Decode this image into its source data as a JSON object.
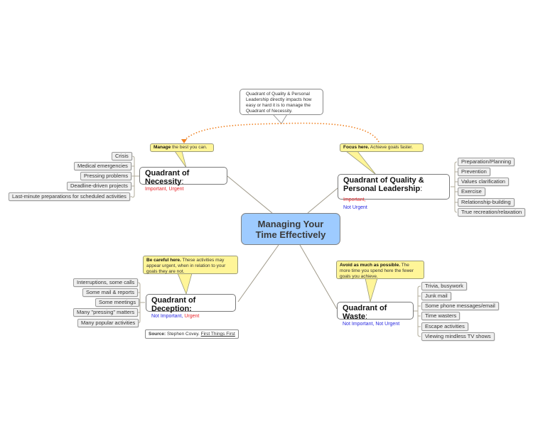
{
  "central": {
    "line1": "Managing Your",
    "line2": "Time Effectively"
  },
  "quadrants": {
    "necessity": {
      "title": "Quadrant of Necessity",
      "colon": ":",
      "importance": "Important",
      "sep": ", ",
      "urgency": "Urgent",
      "items": [
        "Crisis",
        "Medical emergencies",
        "Pressing problems",
        "Deadline-driven projects",
        "Last-minute preparations for scheduled activities"
      ],
      "callout": {
        "bold": "Manage",
        "text": " the best you can."
      }
    },
    "quality": {
      "title_line1": "Quadrant of Quality &",
      "title_line2": "Personal Leadership",
      "colon": ":",
      "importance": " Important,",
      "urgency": "Not Urgent",
      "items": [
        "Preparation/Planning",
        "Prevention",
        "Values clarification",
        "Exercise",
        "Relationship-building",
        "True recreation/relaxation"
      ],
      "callout": {
        "bold": "Focus here.",
        "text": "  Achieve goals faster."
      }
    },
    "deception": {
      "title": "Quadrant of Deception:",
      "importance": "Not Important",
      "sep": ", ",
      "urgency": "Urgent",
      "items": [
        "Interruptions, some calls",
        "Some mail & reports",
        "Some meetings",
        "Many \"pressing\" matters",
        "Many popular activities"
      ],
      "callout": {
        "bold": "Be careful here.",
        "text": "  These activities may appear urgent, when in relation to your goals they are not."
      }
    },
    "waste": {
      "title": "Quadrant of Waste",
      "colon": ":",
      "importance": "Not Important",
      "sep": ", ",
      "urgency": "Not Urgent",
      "items": [
        "Trivia, busywork",
        "Junk mail",
        "Some phone messages/email",
        "Time wasters",
        "Escape activities",
        "Viewing mindless TV shows"
      ],
      "callout": {
        "bold": "Avoid as much as possible.",
        "text": "  The more time you spend here the fewer goals you achieve."
      }
    }
  },
  "relationship_note": "Quadrant of Quality & Personal Leadership directly impacts how easy or hard it is to manage the Quadrant of Necessity.",
  "source": {
    "label": "Source:",
    "author": " Stephen Covey. ",
    "book": "First Things First"
  },
  "colors": {
    "central_fill": "#9ecbff",
    "callout_fill": "#fff598",
    "important": "#e8262b",
    "not_important": "#2a2ae0",
    "relationship_line": "#f08020"
  }
}
